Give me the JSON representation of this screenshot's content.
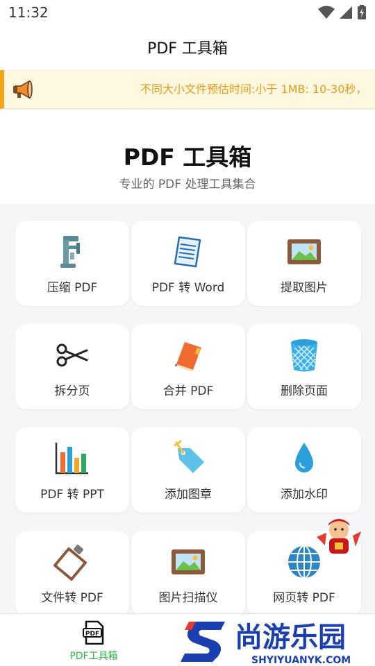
{
  "status_bar": {
    "time": "11:32",
    "icons": [
      "wifi-icon",
      "cell-signal-icon",
      "battery-icon"
    ]
  },
  "app_bar": {
    "title": "PDF 工具箱"
  },
  "notice": {
    "icon": "megaphone-icon",
    "text": "不同大小文件预估时间:小于 1MB: 10-30秒，"
  },
  "hero": {
    "title": "PDF 工具箱",
    "subtitle": "专业的 PDF 处理工具集合"
  },
  "tools": [
    {
      "label": "压缩 PDF",
      "icon": "clamp-icon"
    },
    {
      "label": "PDF 转 Word",
      "icon": "document-icon"
    },
    {
      "label": "提取图片",
      "icon": "picture-frame-icon"
    },
    {
      "label": "拆分页",
      "icon": "scissors-icon"
    },
    {
      "label": "合并 PDF",
      "icon": "book-icon"
    },
    {
      "label": "删除页面",
      "icon": "trash-bin-icon"
    },
    {
      "label": "PDF 转 PPT",
      "icon": "bar-chart-icon"
    },
    {
      "label": "添加图章",
      "icon": "tag-icon"
    },
    {
      "label": "添加水印",
      "icon": "water-drop-icon"
    },
    {
      "label": "文件转 PDF",
      "icon": "clipboard-icon"
    },
    {
      "label": "图片扫描仪",
      "icon": "picture-frame-icon"
    },
    {
      "label": "网页转 PDF",
      "icon": "globe-icon"
    }
  ],
  "bottom_nav": {
    "items": [
      {
        "label": "PDF工具箱",
        "icon": "pdf-file-icon",
        "active": true
      }
    ]
  },
  "watermark": {
    "title": "尚游乐园",
    "url": "SHYIYUANYK.COM"
  },
  "colors": {
    "accent": "#2db84d",
    "notice_text": "#e89a14",
    "notice_bg": "#fff8e1"
  }
}
